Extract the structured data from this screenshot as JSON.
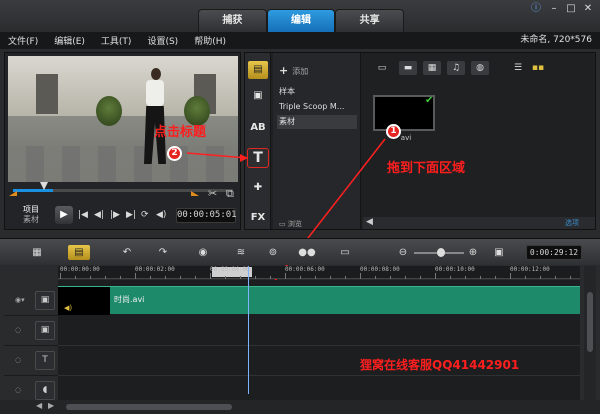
{
  "top_tabs": [
    "捕获",
    "编辑",
    "共享"
  ],
  "window_controls": [
    "help-icon",
    "minimize-icon",
    "maximize-icon",
    "close-icon"
  ],
  "menu": [
    "文件(F)",
    "编辑(E)",
    "工具(T)",
    "设置(S)",
    "帮助(H)"
  ],
  "project_info": "未命名, 720*576",
  "preview": {
    "mode_project": "项目",
    "mode_clip": "素材",
    "timecode": "00:00:05:01"
  },
  "library": {
    "add_label": "添加",
    "categories": [
      "样本",
      "Triple Scoop M...",
      "素材"
    ],
    "selected_category": "素材",
    "browse_label": "浏览",
    "thumbnail_label": "avi",
    "options_label": "选项"
  },
  "annotations": {
    "click_title": "点击标题",
    "drag_to_area": "拖到下面区域",
    "step1": "1",
    "step2": "2",
    "watermark": "狸窝在线客服QQ41442901"
  },
  "timeline": {
    "timecode": "0:00:29:12",
    "ruler_labels": [
      "00:00:00:00",
      "00:00:02:00",
      "00:00:04:00",
      "00:00:06:00",
      "00:00:08:00",
      "00:00:10:00",
      "00:00:12:00"
    ],
    "clip_name": "时尚.avi",
    "playhead_progress": 0.36
  },
  "colors": {
    "accent_tab": "#1f86d0",
    "clip_green": "#1d8a6a",
    "annotation_red": "#ff1e1e",
    "timeline_selected": "#d4b032"
  }
}
